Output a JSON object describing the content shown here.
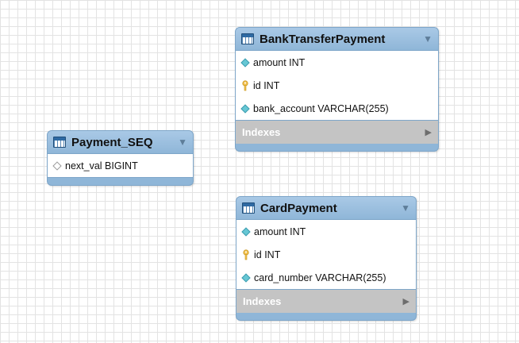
{
  "tables": [
    {
      "name": "BankTransferPayment",
      "columns": [
        {
          "text": "amount INT",
          "kind": "column"
        },
        {
          "text": "id INT",
          "kind": "primary-key"
        },
        {
          "text": "bank_account VARCHAR(255)",
          "kind": "column"
        }
      ],
      "indexes_label": "Indexes"
    },
    {
      "name": "Payment_SEQ",
      "columns": [
        {
          "text": "next_val BIGINT",
          "kind": "nullable-column"
        }
      ]
    },
    {
      "name": "CardPayment",
      "columns": [
        {
          "text": "amount INT",
          "kind": "column"
        },
        {
          "text": "id INT",
          "kind": "primary-key"
        },
        {
          "text": "card_number VARCHAR(255)",
          "kind": "column"
        }
      ],
      "indexes_label": "Indexes"
    }
  ],
  "icons": {
    "table": "table-icon",
    "collapse": "collapse-triangle-icon",
    "expand": "expand-arrow-icon",
    "column": "cyan-diamond-icon",
    "nullable_column": "hollow-diamond-icon",
    "primary_key": "key-icon"
  },
  "colors": {
    "header": "#8fb6d8",
    "column_diamond": "#66c7d4",
    "primary_key": "#f2c14e",
    "indexes_bar": "#c4c4c4"
  }
}
